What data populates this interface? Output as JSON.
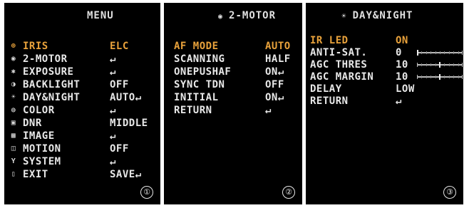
{
  "panels": [
    {
      "title": "MENU",
      "title_icon": "",
      "number": "①",
      "rows": [
        {
          "icon": "⊕",
          "icon_name": "iris-icon",
          "label": "IRIS",
          "value": "ELC",
          "highlight": true
        },
        {
          "icon": "◉",
          "icon_name": "motor-icon",
          "label": "2-MOTOR",
          "value": "↵",
          "highlight": false
        },
        {
          "icon": "✱",
          "icon_name": "exposure-icon",
          "label": "EXPOSURE",
          "value": "↵",
          "highlight": false
        },
        {
          "icon": "◑",
          "icon_name": "backlight-icon",
          "label": "BACKLIGHT",
          "value": "OFF",
          "highlight": false
        },
        {
          "icon": "☀",
          "icon_name": "day-night-icon",
          "label": "DAY&NIGHT",
          "value": "AUTO↵",
          "highlight": false
        },
        {
          "icon": "◍",
          "icon_name": "color-icon",
          "label": "COLOR",
          "value": "↵",
          "highlight": false
        },
        {
          "icon": "▣",
          "icon_name": "dnr-icon",
          "label": "DNR",
          "value": "MIDDLE",
          "highlight": false
        },
        {
          "icon": "▩",
          "icon_name": "image-icon",
          "label": "IMAGE",
          "value": "↵",
          "highlight": false
        },
        {
          "icon": "◫",
          "icon_name": "motion-icon",
          "label": "MOTION",
          "value": "OFF",
          "highlight": false
        },
        {
          "icon": "Y",
          "icon_name": "system-icon",
          "label": "SYSTEM",
          "value": "↵",
          "highlight": false
        },
        {
          "icon": "▯",
          "icon_name": "exit-icon",
          "label": "EXIT",
          "value": "SAVE↵",
          "highlight": false
        }
      ]
    },
    {
      "title": "2-MOTOR",
      "title_icon": "◉",
      "number": "②",
      "rows": [
        {
          "label": "AF MODE",
          "value": "AUTO",
          "highlight": true
        },
        {
          "label": "SCANNING",
          "value": "HALF",
          "highlight": false
        },
        {
          "label": "ONEPUSHAF",
          "value": "ON↵",
          "highlight": false
        },
        {
          "label": "SYNC TDN",
          "value": "OFF",
          "highlight": false
        },
        {
          "label": "INITIAL",
          "value": "ON↵",
          "highlight": false
        },
        {
          "label": "RETURN",
          "value": "↵",
          "highlight": false
        }
      ]
    },
    {
      "title": "DAY&NIGHT",
      "title_icon": "☀",
      "number": "③",
      "rows": [
        {
          "label": "IR LED",
          "value": "ON",
          "highlight": true,
          "slider": null
        },
        {
          "label": "ANTI-SAT.",
          "value": "0",
          "highlight": false,
          "slider": 0.0
        },
        {
          "label": "AGC THRES",
          "value": "10",
          "highlight": false,
          "slider": 0.5
        },
        {
          "label": "AGC MARGIN",
          "value": "10",
          "highlight": false,
          "slider": 0.5
        },
        {
          "label": "DELAY",
          "value": "LOW",
          "highlight": false,
          "slider": null
        },
        {
          "label": "RETURN",
          "value": "↵",
          "highlight": false,
          "slider": null
        }
      ]
    }
  ],
  "colors": {
    "highlight": "#e9a23b",
    "text": "#e8e8e8",
    "background": "#000000"
  }
}
